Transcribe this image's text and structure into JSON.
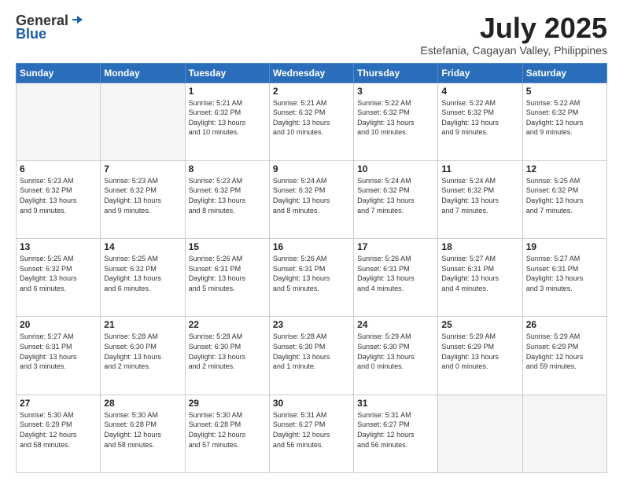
{
  "header": {
    "logo_general": "General",
    "logo_blue": "Blue",
    "title": "July 2025",
    "subtitle": "Estefania, Cagayan Valley, Philippines"
  },
  "weekdays": [
    "Sunday",
    "Monday",
    "Tuesday",
    "Wednesday",
    "Thursday",
    "Friday",
    "Saturday"
  ],
  "weeks": [
    [
      {
        "day": "",
        "info": ""
      },
      {
        "day": "",
        "info": ""
      },
      {
        "day": "1",
        "info": "Sunrise: 5:21 AM\nSunset: 6:32 PM\nDaylight: 13 hours\nand 10 minutes."
      },
      {
        "day": "2",
        "info": "Sunrise: 5:21 AM\nSunset: 6:32 PM\nDaylight: 13 hours\nand 10 minutes."
      },
      {
        "day": "3",
        "info": "Sunrise: 5:22 AM\nSunset: 6:32 PM\nDaylight: 13 hours\nand 10 minutes."
      },
      {
        "day": "4",
        "info": "Sunrise: 5:22 AM\nSunset: 6:32 PM\nDaylight: 13 hours\nand 9 minutes."
      },
      {
        "day": "5",
        "info": "Sunrise: 5:22 AM\nSunset: 6:32 PM\nDaylight: 13 hours\nand 9 minutes."
      }
    ],
    [
      {
        "day": "6",
        "info": "Sunrise: 5:23 AM\nSunset: 6:32 PM\nDaylight: 13 hours\nand 9 minutes."
      },
      {
        "day": "7",
        "info": "Sunrise: 5:23 AM\nSunset: 6:32 PM\nDaylight: 13 hours\nand 9 minutes."
      },
      {
        "day": "8",
        "info": "Sunrise: 5:23 AM\nSunset: 6:32 PM\nDaylight: 13 hours\nand 8 minutes."
      },
      {
        "day": "9",
        "info": "Sunrise: 5:24 AM\nSunset: 6:32 PM\nDaylight: 13 hours\nand 8 minutes."
      },
      {
        "day": "10",
        "info": "Sunrise: 5:24 AM\nSunset: 6:32 PM\nDaylight: 13 hours\nand 7 minutes."
      },
      {
        "day": "11",
        "info": "Sunrise: 5:24 AM\nSunset: 6:32 PM\nDaylight: 13 hours\nand 7 minutes."
      },
      {
        "day": "12",
        "info": "Sunrise: 5:25 AM\nSunset: 6:32 PM\nDaylight: 13 hours\nand 7 minutes."
      }
    ],
    [
      {
        "day": "13",
        "info": "Sunrise: 5:25 AM\nSunset: 6:32 PM\nDaylight: 13 hours\nand 6 minutes."
      },
      {
        "day": "14",
        "info": "Sunrise: 5:25 AM\nSunset: 6:32 PM\nDaylight: 13 hours\nand 6 minutes."
      },
      {
        "day": "15",
        "info": "Sunrise: 5:26 AM\nSunset: 6:31 PM\nDaylight: 13 hours\nand 5 minutes."
      },
      {
        "day": "16",
        "info": "Sunrise: 5:26 AM\nSunset: 6:31 PM\nDaylight: 13 hours\nand 5 minutes."
      },
      {
        "day": "17",
        "info": "Sunrise: 5:26 AM\nSunset: 6:31 PM\nDaylight: 13 hours\nand 4 minutes."
      },
      {
        "day": "18",
        "info": "Sunrise: 5:27 AM\nSunset: 6:31 PM\nDaylight: 13 hours\nand 4 minutes."
      },
      {
        "day": "19",
        "info": "Sunrise: 5:27 AM\nSunset: 6:31 PM\nDaylight: 13 hours\nand 3 minutes."
      }
    ],
    [
      {
        "day": "20",
        "info": "Sunrise: 5:27 AM\nSunset: 6:31 PM\nDaylight: 13 hours\nand 3 minutes."
      },
      {
        "day": "21",
        "info": "Sunrise: 5:28 AM\nSunset: 6:30 PM\nDaylight: 13 hours\nand 2 minutes."
      },
      {
        "day": "22",
        "info": "Sunrise: 5:28 AM\nSunset: 6:30 PM\nDaylight: 13 hours\nand 2 minutes."
      },
      {
        "day": "23",
        "info": "Sunrise: 5:28 AM\nSunset: 6:30 PM\nDaylight: 13 hours\nand 1 minute."
      },
      {
        "day": "24",
        "info": "Sunrise: 5:29 AM\nSunset: 6:30 PM\nDaylight: 13 hours\nand 0 minutes."
      },
      {
        "day": "25",
        "info": "Sunrise: 5:29 AM\nSunset: 6:29 PM\nDaylight: 13 hours\nand 0 minutes."
      },
      {
        "day": "26",
        "info": "Sunrise: 5:29 AM\nSunset: 6:29 PM\nDaylight: 12 hours\nand 59 minutes."
      }
    ],
    [
      {
        "day": "27",
        "info": "Sunrise: 5:30 AM\nSunset: 6:29 PM\nDaylight: 12 hours\nand 58 minutes."
      },
      {
        "day": "28",
        "info": "Sunrise: 5:30 AM\nSunset: 6:28 PM\nDaylight: 12 hours\nand 58 minutes."
      },
      {
        "day": "29",
        "info": "Sunrise: 5:30 AM\nSunset: 6:28 PM\nDaylight: 12 hours\nand 57 minutes."
      },
      {
        "day": "30",
        "info": "Sunrise: 5:31 AM\nSunset: 6:27 PM\nDaylight: 12 hours\nand 56 minutes."
      },
      {
        "day": "31",
        "info": "Sunrise: 5:31 AM\nSunset: 6:27 PM\nDaylight: 12 hours\nand 56 minutes."
      },
      {
        "day": "",
        "info": ""
      },
      {
        "day": "",
        "info": ""
      }
    ]
  ]
}
